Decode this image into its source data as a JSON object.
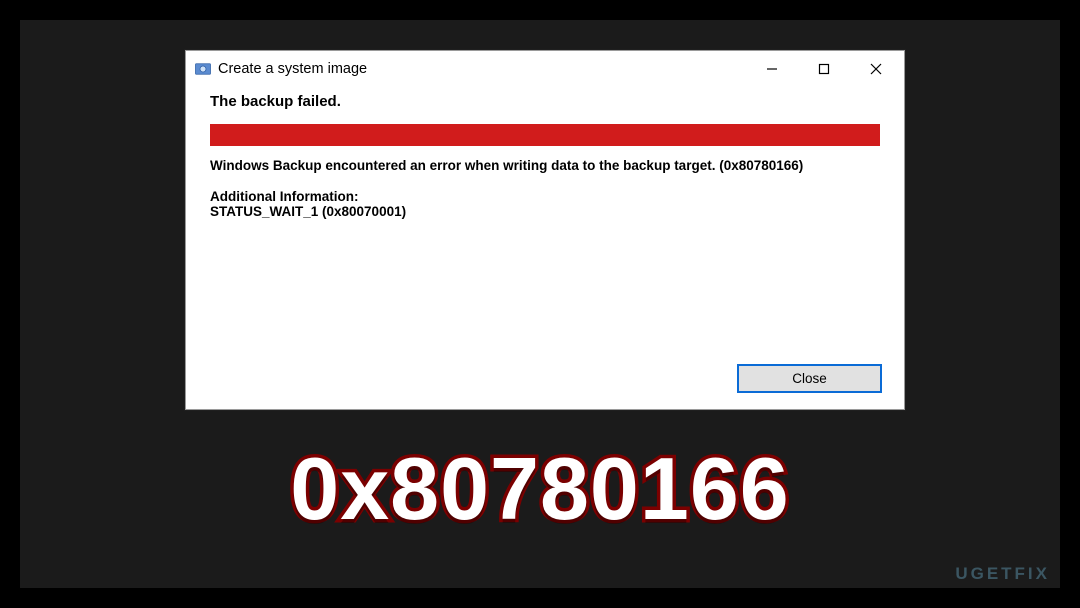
{
  "dialog": {
    "title": "Create a system image",
    "heading": "The backup failed.",
    "error_message": "Windows Backup encountered an error when writing data to the backup target. (0x80780166)",
    "additional_label": "Additional Information:",
    "additional_value": "STATUS_WAIT_1 (0x80070001)",
    "close_label": "Close"
  },
  "overlay": {
    "big_code": "0x80780166",
    "watermark": "UGETFIX"
  }
}
